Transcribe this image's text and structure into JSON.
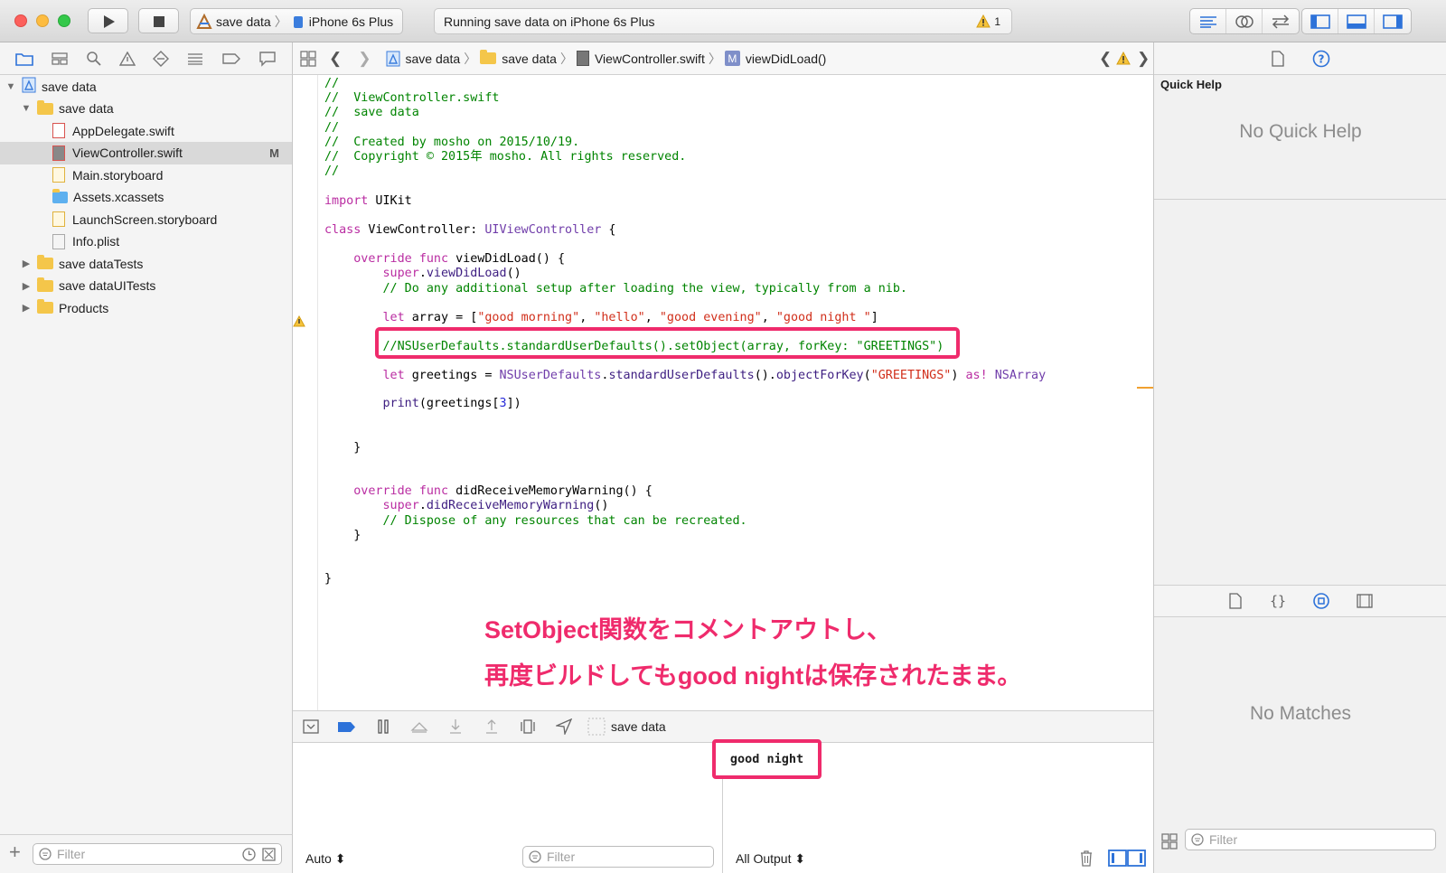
{
  "toolbar": {
    "scheme_target": "save data",
    "scheme_device": "iPhone 6s Plus",
    "activity_text": "Running save data on iPhone 6s Plus",
    "warning_count": "1",
    "colors": {
      "close": "#fc605c",
      "minimize": "#fdbc40",
      "zoom": "#34c84a",
      "accent": "#1f7cf6"
    }
  },
  "navigator": {
    "tabs": [
      "folder-icon",
      "symbol-icon",
      "search-icon",
      "issue-icon",
      "test-icon",
      "debug-icon",
      "breakpoint-icon",
      "report-icon"
    ],
    "tree": [
      {
        "label": "save data",
        "kind": "project",
        "indent": 0,
        "disclosure": "▼"
      },
      {
        "label": "save data",
        "kind": "folder",
        "indent": 1,
        "disclosure": "▼"
      },
      {
        "label": "AppDelegate.swift",
        "kind": "swift",
        "indent": 2,
        "disclosure": ""
      },
      {
        "label": "ViewController.swift",
        "kind": "swift",
        "indent": 2,
        "disclosure": "",
        "badge": "M",
        "selected": true
      },
      {
        "label": "Main.storyboard",
        "kind": "storyboard",
        "indent": 2,
        "disclosure": ""
      },
      {
        "label": "Assets.xcassets",
        "kind": "assets",
        "indent": 2,
        "disclosure": ""
      },
      {
        "label": "LaunchScreen.storyboard",
        "kind": "storyboard",
        "indent": 2,
        "disclosure": ""
      },
      {
        "label": "Info.plist",
        "kind": "plist",
        "indent": 2,
        "disclosure": ""
      },
      {
        "label": "save dataTests",
        "kind": "folder",
        "indent": 1,
        "disclosure": "▶"
      },
      {
        "label": "save dataUITests",
        "kind": "folder",
        "indent": 1,
        "disclosure": "▶"
      },
      {
        "label": "Products",
        "kind": "folder",
        "indent": 1,
        "disclosure": "▶"
      }
    ],
    "filter_placeholder": "Filter"
  },
  "jumpbar": {
    "crumbs": [
      "save data",
      "save data",
      "ViewController.swift",
      "viewDidLoad()"
    ],
    "method_badge": "M"
  },
  "code": {
    "lines": [
      [
        {
          "c": "c",
          "t": "//"
        }
      ],
      [
        {
          "c": "c",
          "t": "//  ViewController.swift"
        }
      ],
      [
        {
          "c": "c",
          "t": "//  save data"
        }
      ],
      [
        {
          "c": "c",
          "t": "//"
        }
      ],
      [
        {
          "c": "c",
          "t": "//  Created by mosho on 2015/10/19."
        }
      ],
      [
        {
          "c": "c",
          "t": "//  Copyright © 2015年 mosho. All rights reserved."
        }
      ],
      [
        {
          "c": "c",
          "t": "//"
        }
      ],
      [],
      [
        {
          "c": "k",
          "t": "import"
        },
        {
          "c": "",
          "t": " UIKit"
        }
      ],
      [],
      [
        {
          "c": "k",
          "t": "class"
        },
        {
          "c": "",
          "t": " ViewController: "
        },
        {
          "c": "t",
          "t": "UIViewController"
        },
        {
          "c": "",
          "t": " {"
        }
      ],
      [],
      [
        {
          "c": "",
          "t": "    "
        },
        {
          "c": "k",
          "t": "override"
        },
        {
          "c": "",
          "t": " "
        },
        {
          "c": "k",
          "t": "func"
        },
        {
          "c": "",
          "t": " viewDidLoad() {"
        }
      ],
      [
        {
          "c": "",
          "t": "        "
        },
        {
          "c": "k",
          "t": "super"
        },
        {
          "c": "",
          "t": "."
        },
        {
          "c": "f",
          "t": "viewDidLoad"
        },
        {
          "c": "",
          "t": "()"
        }
      ],
      [
        {
          "c": "",
          "t": "        "
        },
        {
          "c": "c",
          "t": "// Do any additional setup after loading the view, typically from a nib."
        }
      ],
      [],
      [
        {
          "c": "",
          "t": "        "
        },
        {
          "c": "k",
          "t": "let"
        },
        {
          "c": "",
          "t": " array = ["
        },
        {
          "c": "s",
          "t": "\"good morning\""
        },
        {
          "c": "",
          "t": ", "
        },
        {
          "c": "s",
          "t": "\"hello\""
        },
        {
          "c": "",
          "t": ", "
        },
        {
          "c": "s",
          "t": "\"good evening\""
        },
        {
          "c": "",
          "t": ", "
        },
        {
          "c": "s",
          "t": "\"good night \""
        },
        {
          "c": "",
          "t": "]"
        }
      ],
      [],
      [
        {
          "c": "",
          "t": "        "
        },
        {
          "c": "c",
          "t": "//NSUserDefaults.standardUserDefaults().setObject(array, forKey: \"GREETINGS\")"
        }
      ],
      [],
      [
        {
          "c": "",
          "t": "        "
        },
        {
          "c": "k",
          "t": "let"
        },
        {
          "c": "",
          "t": " greetings = "
        },
        {
          "c": "t",
          "t": "NSUserDefaults"
        },
        {
          "c": "",
          "t": "."
        },
        {
          "c": "f",
          "t": "standardUserDefaults"
        },
        {
          "c": "",
          "t": "()."
        },
        {
          "c": "f",
          "t": "objectForKey"
        },
        {
          "c": "",
          "t": "("
        },
        {
          "c": "s",
          "t": "\"GREETINGS\""
        },
        {
          "c": "",
          "t": ") "
        },
        {
          "c": "k",
          "t": "as!"
        },
        {
          "c": "",
          "t": " "
        },
        {
          "c": "t",
          "t": "NSArray"
        }
      ],
      [],
      [
        {
          "c": "",
          "t": "        "
        },
        {
          "c": "f",
          "t": "print"
        },
        {
          "c": "",
          "t": "(greetings["
        },
        {
          "c": "n",
          "t": "3"
        },
        {
          "c": "",
          "t": "])"
        }
      ],
      [],
      [],
      [
        {
          "c": "",
          "t": "    }"
        }
      ],
      [],
      [],
      [
        {
          "c": "",
          "t": "    "
        },
        {
          "c": "k",
          "t": "override"
        },
        {
          "c": "",
          "t": " "
        },
        {
          "c": "k",
          "t": "func"
        },
        {
          "c": "",
          "t": " didReceiveMemoryWarning() {"
        }
      ],
      [
        {
          "c": "",
          "t": "        "
        },
        {
          "c": "k",
          "t": "super"
        },
        {
          "c": "",
          "t": "."
        },
        {
          "c": "f",
          "t": "didReceiveMemoryWarning"
        },
        {
          "c": "",
          "t": "()"
        }
      ],
      [
        {
          "c": "",
          "t": "        "
        },
        {
          "c": "c",
          "t": "// Dispose of any resources that can be recreated."
        }
      ],
      [
        {
          "c": "",
          "t": "    }"
        }
      ],
      [],
      [],
      [
        {
          "c": "",
          "t": "}"
        }
      ]
    ],
    "warning_line": 17
  },
  "annotation": {
    "line1": "SetObject関数をコメントアウトし、",
    "line2": "再度ビルドしてもgood nightは保存されたまま。",
    "color": "#ef2b6c"
  },
  "debugbar": {
    "target_label": "save data"
  },
  "variables": {
    "scope_select": "Auto ⬍",
    "filter_placeholder": "Filter"
  },
  "console": {
    "output": "good night",
    "output_select": "All Output ⬍"
  },
  "inspector": {
    "quick_help_title": "Quick Help",
    "no_quick_help": "No Quick Help",
    "no_matches": "No Matches",
    "filter_placeholder": "Filter"
  }
}
